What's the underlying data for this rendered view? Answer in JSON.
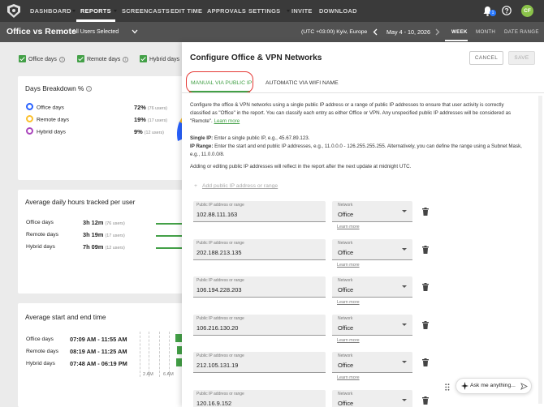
{
  "nav": {
    "items": [
      {
        "label": "DASHBOARD",
        "caret": true
      },
      {
        "label": "REPORTS",
        "caret": true,
        "active": true
      },
      {
        "label": "SCREENCASTS"
      },
      {
        "label": "EDIT TIME"
      },
      {
        "label": "APPROVALS"
      },
      {
        "label": "SETTINGS",
        "caret": true
      },
      {
        "label": "INVITE"
      },
      {
        "label": "DOWNLOAD"
      }
    ],
    "notification_count": "1",
    "avatar_initials": "CF",
    "icons": [
      "logo-icon",
      "bell-icon",
      "help-icon"
    ]
  },
  "subheader": {
    "title": "Office vs Remote",
    "users_select": "All Users Selected",
    "timezone": "(UTC +03:00) Kyiv, Europe",
    "date_range": "May 4 - 10, 2026",
    "views": [
      {
        "label": "WEEK",
        "active": true
      },
      {
        "label": "MONTH"
      },
      {
        "label": "DATE RANGE"
      }
    ]
  },
  "filters": {
    "office_days": "Office days",
    "remote_days": "Remote days",
    "hybrid_days": "Hybrid days"
  },
  "breakdown": {
    "title": "Days Breakdown %",
    "rows": [
      {
        "label": "Office days",
        "pct": "72%",
        "users": "(76 users)",
        "color": "#2962ff"
      },
      {
        "label": "Remote days",
        "pct": "19%",
        "users": "(17 users)",
        "color": "#fbc02d"
      },
      {
        "label": "Hybrid days",
        "pct": "9%",
        "users": "(12 users)",
        "color": "#ab47bc"
      }
    ]
  },
  "avg_hours": {
    "title": "Average daily hours tracked per user",
    "rows": [
      {
        "label": "Office days",
        "value": "3h 12m",
        "users": "(76 users)"
      },
      {
        "label": "Remote days",
        "value": "3h 19m",
        "users": "(17 users)"
      },
      {
        "label": "Hybrid days",
        "value": "7h 09m",
        "users": "(12 users)"
      }
    ]
  },
  "avg_start_end": {
    "title": "Average start and end time",
    "rows": [
      {
        "label": "Office days",
        "value": "07:09 AM - 11:55 AM"
      },
      {
        "label": "Remote days",
        "value": "08:19 AM - 11:25 AM"
      },
      {
        "label": "Hybrid days",
        "value": "07:48 AM - 06:19 PM"
      }
    ],
    "axis": [
      "2 AM",
      "6 AM"
    ]
  },
  "panel": {
    "title": "Configure Office & VPN Networks",
    "cancel": "CANCEL",
    "save": "SAVE",
    "tabs": [
      "MANUAL VIA PUBLIC IP",
      "AUTOMATIC VIA WIFI NAME"
    ],
    "description": "Configure the office & VPN networks using a single public IP address or a range of public IP addresses to ensure that user activity is correctly classified as \"Office\" in the report. You can classify each entry as either Office or VPN. Any unspecified public IP addresses will be considered as \"Remote\".",
    "learn_more": "Learn more",
    "single_ip_label": "Single IP:",
    "single_ip_text": "Enter a single public IP, e.g., 45.67.89.123.",
    "ip_range_label": "IP Range:",
    "ip_range_text": "Enter the start and end public IP addresses, e.g., 11.0.0.0 - 126.255.255.255. Alternatively, you can define the range using a Subnet Mask, e.g., 11.0.0.0/8.",
    "notice": "Adding or editing public IP addresses will reflect in the report after the next update at midnight UTC.",
    "add_label": "Add public IP address or range",
    "field_label": "Public IP address or range",
    "network_label": "Network",
    "entries": [
      {
        "ip": "102.88.111.163",
        "network": "Office"
      },
      {
        "ip": "202.188.213.135",
        "network": "Office"
      },
      {
        "ip": "106.194.228.203",
        "network": "Office"
      },
      {
        "ip": "106.216.130.20",
        "network": "Office"
      },
      {
        "ip": "212.105.131.19",
        "network": "Office"
      },
      {
        "ip": "120.16.9.152",
        "network": "Office"
      }
    ]
  },
  "assistant": {
    "placeholder": "Ask me anything..."
  }
}
